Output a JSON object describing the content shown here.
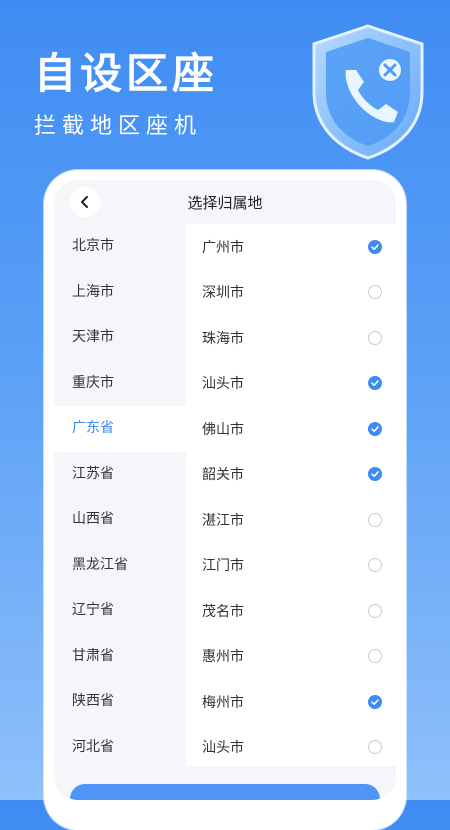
{
  "hero": {
    "title": "自设区座",
    "subtitle": "拦截地区座机"
  },
  "icons": {
    "shield": "shield-phone-block-icon",
    "back": "chevron-left-icon",
    "check": "check-circle-icon"
  },
  "header": {
    "title": "选择归属地"
  },
  "colors": {
    "accent": "#3d8bf5",
    "background_top": "#3f8cf3",
    "background_bottom": "#8fc0fa"
  },
  "provinces": [
    {
      "label": "北京市",
      "selected": false
    },
    {
      "label": "上海市",
      "selected": false
    },
    {
      "label": "天津市",
      "selected": false
    },
    {
      "label": "重庆市",
      "selected": false
    },
    {
      "label": "广东省",
      "selected": true
    },
    {
      "label": "江苏省",
      "selected": false
    },
    {
      "label": "山西省",
      "selected": false
    },
    {
      "label": "黑龙江省",
      "selected": false
    },
    {
      "label": "辽宁省",
      "selected": false
    },
    {
      "label": "甘肃省",
      "selected": false
    },
    {
      "label": "陕西省",
      "selected": false
    },
    {
      "label": "河北省",
      "selected": false
    }
  ],
  "cities": [
    {
      "label": "广州市",
      "checked": true
    },
    {
      "label": "深圳市",
      "checked": false
    },
    {
      "label": "珠海市",
      "checked": false
    },
    {
      "label": "汕头市",
      "checked": true
    },
    {
      "label": "佛山市",
      "checked": true
    },
    {
      "label": "韶关市",
      "checked": true
    },
    {
      "label": "湛江市",
      "checked": false
    },
    {
      "label": "江门市",
      "checked": false
    },
    {
      "label": "茂名市",
      "checked": false
    },
    {
      "label": "惠州市",
      "checked": false
    },
    {
      "label": "梅州市",
      "checked": true
    },
    {
      "label": "汕头市",
      "checked": false
    }
  ]
}
